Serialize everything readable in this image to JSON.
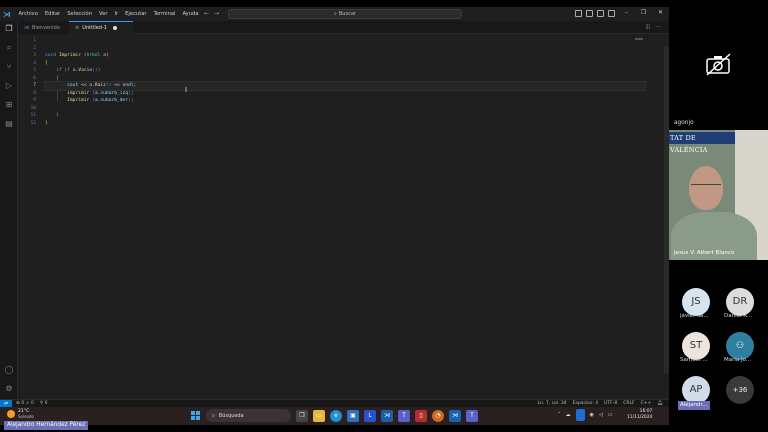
{
  "titlebar": {
    "menu": [
      "Archivo",
      "Editar",
      "Selección",
      "Ver",
      "Ir",
      "Ejecutar",
      "Terminal",
      "Ayuda"
    ],
    "search_label": "Buscar"
  },
  "tabs": [
    {
      "label": "Bienvenido"
    },
    {
      "label": "Untitled-1"
    }
  ],
  "editor": {
    "line_numbers": [
      "1",
      "2",
      "3",
      "4",
      "5",
      "6",
      "7",
      "8",
      "9",
      "10",
      "11",
      "12"
    ],
    "active_line": 7
  },
  "statusbar": {
    "problems": "0",
    "warnings": "0",
    "ports": "0",
    "position": "Ln. 7, col. 34",
    "spaces": "Espacios: 4",
    "encoding": "UTF-8",
    "eol": "CRLF",
    "language": "C++"
  },
  "taskbar": {
    "temperature": "21°C",
    "weather": "Soleado",
    "search_label": "Búsqueda",
    "time": "16:07",
    "date": "11/11/2024"
  },
  "meeting": {
    "participant_top": "agonjo",
    "video_banner": "TAT DE VALÈNCIA",
    "video_name": "Jesus V. Albert Blanco",
    "avatars": [
      {
        "initials": "JS",
        "name": "javier sa...",
        "color": "#d6e4f0"
      },
      {
        "initials": "DR",
        "name": "Daniel R...",
        "color": "#dcdcdc"
      },
      {
        "initials": "ST",
        "name": "Samuel ...",
        "color": "#ece4de"
      },
      {
        "initials": "",
        "name": "Maria Jo...",
        "color": "#2e7fa0"
      },
      {
        "initials": "AP",
        "name": "",
        "color": "#d0dcea"
      }
    ],
    "more_count": "+36",
    "ap_label": "Alejandr..."
  },
  "presenter_label": "Alejandro Hernández Pérez",
  "colors": {
    "accent": "#0078d4",
    "editor_bg": "#1f1f1f",
    "keyword": "#569cd6",
    "function": "#dcdcaa",
    "type": "#4ec9b0",
    "variable": "#9cdcfe"
  }
}
